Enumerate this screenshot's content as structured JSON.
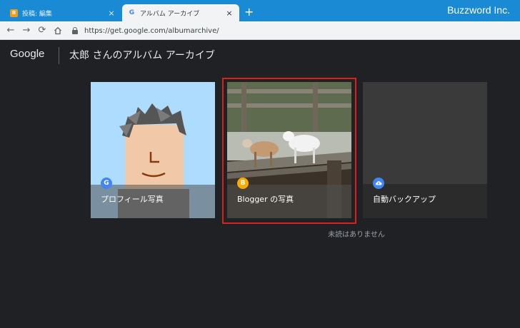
{
  "browser": {
    "tabs": [
      {
        "label": "投稿: 編集",
        "favicon": "B"
      },
      {
        "label": "アルバム アーカイブ",
        "favicon": "G"
      }
    ],
    "new_tab": "+",
    "close": "×",
    "brand": "Buzzword Inc.",
    "url": "https://get.google.com/albumarchive/"
  },
  "header": {
    "logo": "Google",
    "title": "太郎 さんのアルバム アーカイブ"
  },
  "albums": [
    {
      "label": "プロフィール写真",
      "badge": "G",
      "badge_color": "#4285f4"
    },
    {
      "label": "Blogger の写真",
      "badge": "B",
      "badge_color": "#f9ab00"
    },
    {
      "label": "自動バックアップ",
      "badge": "cloud-icon",
      "badge_color": "#4285f4"
    }
  ],
  "status": {
    "unread": "未読はありません"
  },
  "colors": {
    "selection": "#d9201c",
    "tabbar": "#1a8ad4"
  }
}
